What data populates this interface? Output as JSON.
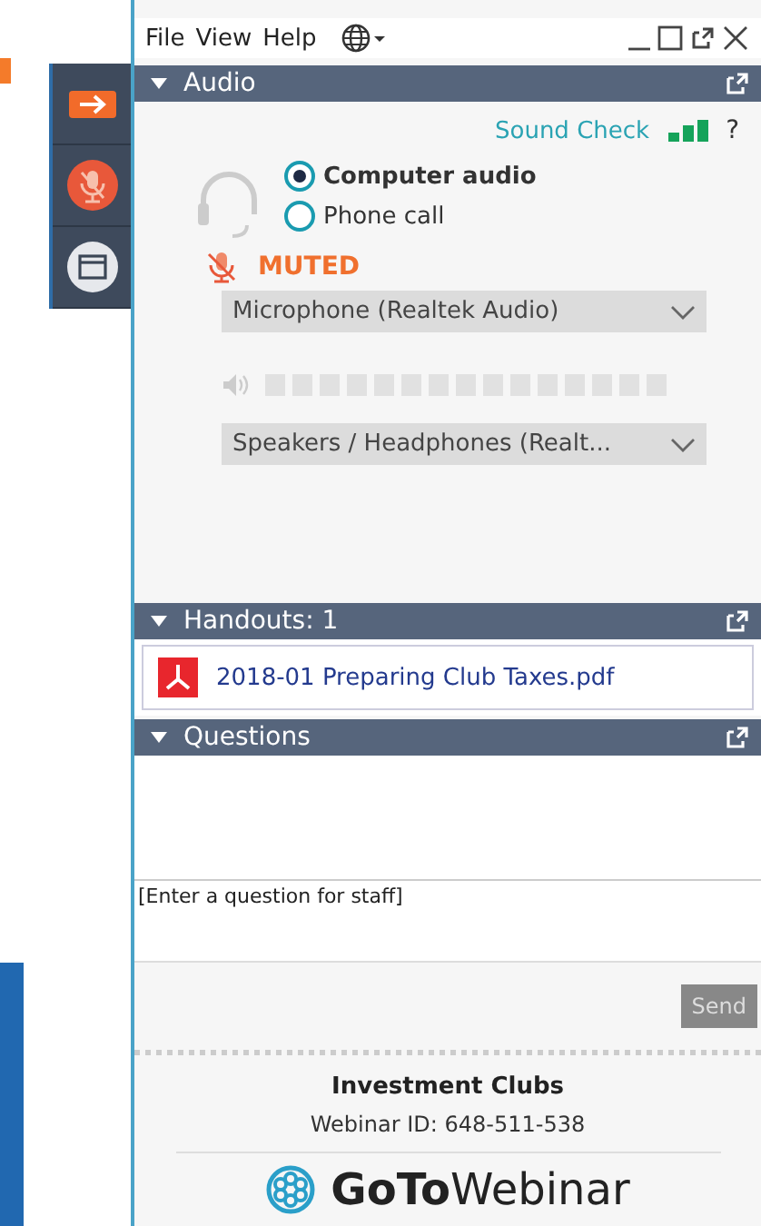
{
  "menu": [
    "File",
    "View",
    "Help"
  ],
  "toolbar": [
    {
      "kind": "arrow"
    },
    {
      "kind": "mic"
    },
    {
      "kind": "window"
    }
  ],
  "audio": {
    "title": "Audio",
    "expanded": true,
    "sound_check": "Sound Check",
    "help": "?",
    "options": [
      {
        "label": "Computer audio",
        "selected": true
      },
      {
        "label": "Phone call",
        "selected": false
      }
    ],
    "mute_status": "MUTED",
    "microphone": "Microphone (Realtek Audio)",
    "speakers": "Speakers / Headphones (Realt..."
  },
  "handouts": {
    "title": "Handouts: 1",
    "expanded": true,
    "files": [
      "2018-01 Preparing Club Taxes.pdf"
    ]
  },
  "questions": {
    "title": "Questions",
    "expanded": true,
    "placeholder": "[Enter a question for staff]",
    "send": "Send"
  },
  "footer": {
    "name": "Investment Clubs",
    "webinar_id": "Webinar ID: 648-511-538",
    "logo": "**GoTo**Webinar"
  }
}
